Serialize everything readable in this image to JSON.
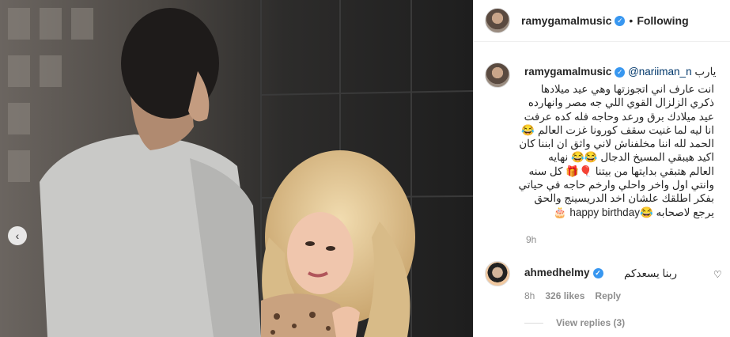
{
  "post": {
    "username": "ramygamalmusic",
    "verified_glyph": "✓",
    "separator": "•",
    "follow_state": "Following"
  },
  "caption": {
    "username": "ramygamalmusic",
    "mention": "@nariiman_n",
    "first_word": "يارب",
    "lines": [
      "انت عارف اني اتجوزتها وهي عيد ميلادها",
      "ذكري الزلزال القوي اللي جه مصر وانهارده",
      "عيد ميلادك برق ورعد وحاجه فله كده عرفت",
      "انا ليه لما غنيت سقف كورونا غزت العالم 😂",
      "الحمد لله اننا مخلفناش لاني واثق ان ابننا كان",
      "اكيد هيبقي المسيخ الدجال 😂😂 نهايه",
      "العالم هتبقي بدايتها من بيتنا 🎈🎁 كل سنه",
      "وانتي اول واخر واحلي وارخم حاجه في حياتي",
      "بفكر اطلقك علشان اخد الدريسينج والحق",
      "يرجع لاصحابه 😂happy birthday 🎂"
    ],
    "time": "9h"
  },
  "comment": {
    "username": "ahmedhelmy",
    "text": "ربنا يسعدكم",
    "time": "8h",
    "likes": "326 likes",
    "reply_label": "Reply",
    "view_replies": "View replies (3)"
  },
  "icons": {
    "prev": "chevron-left-icon",
    "heart": "heart-icon",
    "verified": "verified-badge-icon"
  },
  "colors": {
    "verified": "#3897f0",
    "mention": "#00376b",
    "meta": "#8e8e8e"
  }
}
